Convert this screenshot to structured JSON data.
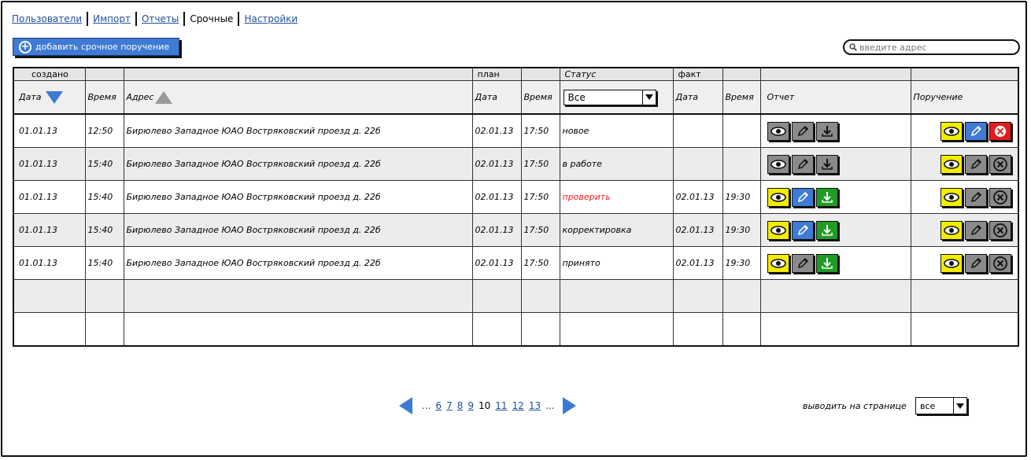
{
  "nav": {
    "users": "Пользователи",
    "import": "Импорт",
    "reports": "Отчеты",
    "urgent": "Срочные",
    "settings": "Настройки"
  },
  "toolbar": {
    "add_label": "добавить срочное поручение",
    "search_placeholder": "введите адрес"
  },
  "table": {
    "group_headers": {
      "created": "создано",
      "plan": "план",
      "status": "Статус",
      "fact": "факт"
    },
    "columns": {
      "date": "Дата",
      "time": "Время",
      "address": "Адрес",
      "plan_date": "Дата",
      "plan_time": "Время",
      "fact_date": "Дата",
      "fact_time": "Время",
      "report": "Отчет",
      "order": "Поручение"
    },
    "status_filter": "Все",
    "rows": [
      {
        "date": "01.01.13",
        "time": "12:50",
        "address": "Бирюлево Западное ЮАО Востряковский проезд д. 22б",
        "plan_date": "02.01.13",
        "plan_time": "17:50",
        "status": "новое",
        "fact_date": "",
        "fact_time": ""
      },
      {
        "date": "01.01.13",
        "time": "15:40",
        "address": "Бирюлево Западное ЮАО Востряковский проезд д. 22б",
        "plan_date": "02.01.13",
        "plan_time": "17:50",
        "status": "в работе",
        "fact_date": "",
        "fact_time": ""
      },
      {
        "date": "01.01.13",
        "time": "15:40",
        "address": "Бирюлево Западное ЮАО Востряковский проезд д. 22б",
        "plan_date": "02.01.13",
        "plan_time": "17:50",
        "status": "проверить",
        "fact_date": "02.01.13",
        "fact_time": "19:30"
      },
      {
        "date": "01.01.13",
        "time": "15:40",
        "address": "Бирюлево Западное ЮАО Востряковский проезд д. 22б",
        "plan_date": "02.01.13",
        "plan_time": "17:50",
        "status": "корректировка",
        "fact_date": "02.01.13",
        "fact_time": "19:30"
      },
      {
        "date": "01.01.13",
        "time": "15:40",
        "address": "Бирюлево Западное ЮАО Востряковский проезд д. 22б",
        "plan_date": "02.01.13",
        "plan_time": "17:50",
        "status": "принято",
        "fact_date": "02.01.13",
        "fact_time": "19:30"
      }
    ]
  },
  "pager": {
    "ellipsis": "...",
    "pages": [
      "6",
      "7",
      "8",
      "9",
      "10",
      "11",
      "12",
      "13"
    ],
    "current": "10"
  },
  "per_page": {
    "label": "выводить на странице",
    "value": "все"
  },
  "colors": {
    "accent": "#3f7ad4",
    "link": "#1f4e9a",
    "status_alert": "#ff1a1a",
    "icon_yellow": "#f2ec00",
    "icon_green": "#1e9c23",
    "icon_red": "#e31c1c",
    "icon_gray": "#8a8a8a"
  },
  "icons": {
    "add": "plus-circle-icon",
    "search": "magnifier-icon",
    "view": "eye-icon",
    "edit": "pencil-icon",
    "download": "download-icon",
    "cancel": "close-circle-icon",
    "sort_desc": "triangle-down-icon",
    "sort_asc": "triangle-up-icon"
  }
}
